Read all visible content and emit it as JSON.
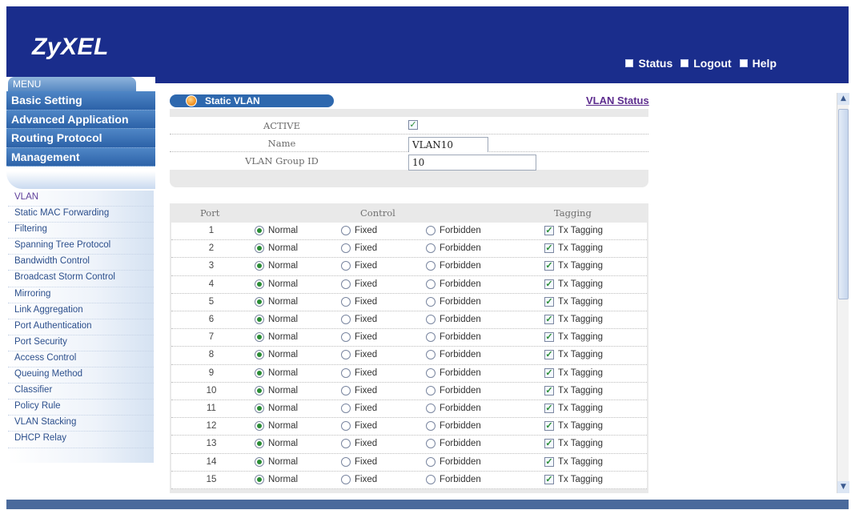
{
  "header": {
    "logo": "ZyXEL",
    "links": [
      {
        "label": "Status",
        "icon": "status-icon"
      },
      {
        "label": "Logout",
        "icon": "logout-icon"
      },
      {
        "label": "Help",
        "icon": "help-icon"
      }
    ]
  },
  "menu": {
    "tab_label": "MENU",
    "main_items": [
      "Basic Setting",
      "Advanced Application",
      "Routing Protocol",
      "Management"
    ],
    "sub_items": [
      "VLAN",
      "Static MAC Forwarding",
      "Filtering",
      "Spanning Tree Protocol",
      "Bandwidth Control",
      "Broadcast Storm Control",
      "Mirroring",
      "Link Aggregation",
      "Port Authentication",
      "Port Security",
      "Access Control",
      "Queuing Method",
      "Classifier",
      "Policy Rule",
      "VLAN Stacking",
      "DHCP Relay"
    ]
  },
  "page": {
    "title": "Static VLAN",
    "status_link": "VLAN Status"
  },
  "form": {
    "active_label": "ACTIVE",
    "active_checked": true,
    "name_label": "Name",
    "name_value": "VLAN10",
    "group_id_label": "VLAN Group ID",
    "group_id_value": "10"
  },
  "ports_table": {
    "headers": {
      "port": "Port",
      "control": "Control",
      "tagging": "Tagging"
    },
    "options": {
      "normal": "Normal",
      "fixed": "Fixed",
      "forbidden": "Forbidden",
      "tagging": "Tx Tagging"
    },
    "rows": [
      {
        "port": "1",
        "control": "normal",
        "tagged": true
      },
      {
        "port": "2",
        "control": "normal",
        "tagged": true
      },
      {
        "port": "3",
        "control": "normal",
        "tagged": true
      },
      {
        "port": "4",
        "control": "normal",
        "tagged": true
      },
      {
        "port": "5",
        "control": "normal",
        "tagged": true
      },
      {
        "port": "6",
        "control": "normal",
        "tagged": true
      },
      {
        "port": "7",
        "control": "normal",
        "tagged": true
      },
      {
        "port": "8",
        "control": "normal",
        "tagged": true
      },
      {
        "port": "9",
        "control": "normal",
        "tagged": true
      },
      {
        "port": "10",
        "control": "normal",
        "tagged": true
      },
      {
        "port": "11",
        "control": "normal",
        "tagged": true
      },
      {
        "port": "12",
        "control": "normal",
        "tagged": true
      },
      {
        "port": "13",
        "control": "normal",
        "tagged": true
      },
      {
        "port": "14",
        "control": "normal",
        "tagged": true
      },
      {
        "port": "15",
        "control": "normal",
        "tagged": true
      }
    ]
  },
  "colors": {
    "header_bg": "#1a2d8c",
    "menu_bg": "#2e68ae",
    "status_link": "#5d2c8e",
    "check_green": "#2a8d35"
  }
}
